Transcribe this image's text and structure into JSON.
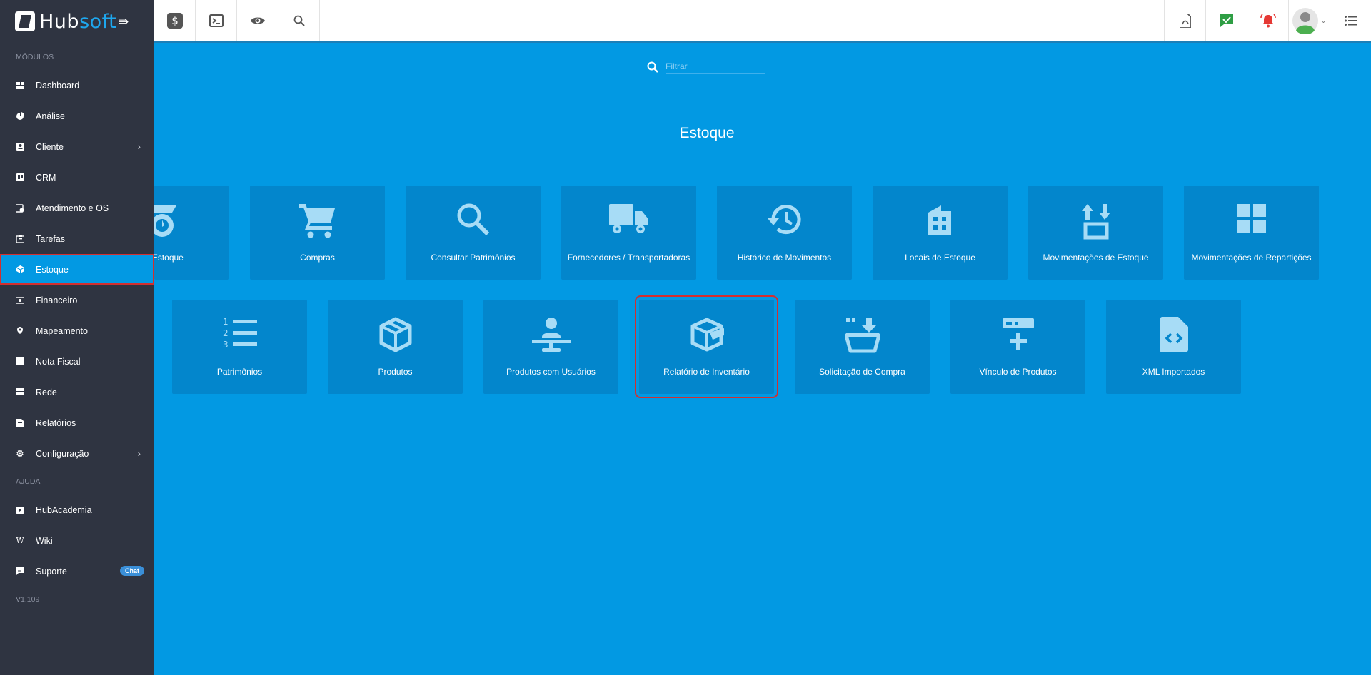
{
  "app": {
    "logo_hub": "Hub",
    "logo_soft": "soft"
  },
  "sidebar": {
    "section_modules": "MÓDULOS",
    "items": [
      {
        "label": "Dashboard"
      },
      {
        "label": "Análise"
      },
      {
        "label": "Cliente"
      },
      {
        "label": "CRM"
      },
      {
        "label": "Atendimento e OS"
      },
      {
        "label": "Tarefas"
      },
      {
        "label": "Estoque"
      },
      {
        "label": "Financeiro"
      },
      {
        "label": "Mapeamento"
      },
      {
        "label": "Nota Fiscal"
      },
      {
        "label": "Rede"
      },
      {
        "label": "Relatórios"
      },
      {
        "label": "Configuração"
      }
    ],
    "section_help": "AJUDA",
    "help_items": [
      {
        "label": "HubAcademia"
      },
      {
        "label": "Wiki"
      },
      {
        "label": "Suporte",
        "badge": "Chat"
      }
    ],
    "version": "V1.109"
  },
  "filter": {
    "placeholder": "Filtrar"
  },
  "page": {
    "title": "Estoque"
  },
  "tiles_row1": [
    {
      "label": "de Estoque",
      "icon": "dispatch-icon"
    },
    {
      "label": "Compras",
      "icon": "cart-icon"
    },
    {
      "label": "Consultar Patrimônios",
      "icon": "search-icon"
    },
    {
      "label": "Fornecedores / Transportadoras",
      "icon": "truck-icon"
    },
    {
      "label": "Histórico de Movimentos",
      "icon": "history-icon"
    },
    {
      "label": "Locais de Estoque",
      "icon": "building-icon"
    },
    {
      "label": "Movimentações de Estoque",
      "icon": "swap-box-icon"
    },
    {
      "label": "Movimentações de Repartições",
      "icon": "grid-icon"
    }
  ],
  "tiles_row2": [
    {
      "label": "Patrimônios",
      "icon": "numbered-list-icon"
    },
    {
      "label": "Produtos",
      "icon": "package-icon"
    },
    {
      "label": "Produtos com Usuários",
      "icon": "person-stand-icon"
    },
    {
      "label": "Relatório de Inventário",
      "icon": "open-box-icon"
    },
    {
      "label": "Solicitação de Compra",
      "icon": "basket-download-icon"
    },
    {
      "label": "Vínculo de Produtos",
      "icon": "link-product-icon"
    },
    {
      "label": "XML Importados",
      "icon": "code-file-icon"
    }
  ],
  "colors": {
    "sidebar": "#2f3441",
    "main": "#0299e3",
    "tile": "#0386cc",
    "highlight": "#d32f2f"
  }
}
